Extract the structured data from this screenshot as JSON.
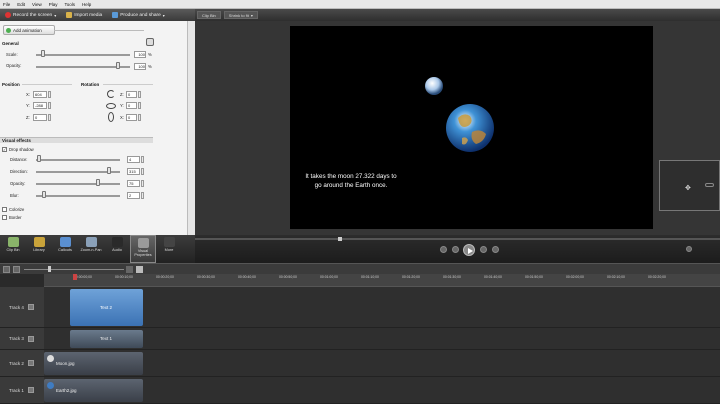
{
  "menu": [
    "File",
    "Edit",
    "View",
    "Play",
    "Tools",
    "Help"
  ],
  "toolbar": {
    "record": "Record the screen",
    "import": "Import media",
    "produce": "Produce and share"
  },
  "right_toolbar": {
    "btn1": "Clip Bin",
    "btn2": "Shrink to fit"
  },
  "panel": {
    "add_animation": "Add animation",
    "general": "General",
    "scale_label": "Scale:",
    "scale_value": "100",
    "opacity_label": "Opacity:",
    "opacity_value": "100",
    "pct": "%",
    "position": "Position",
    "rotation": "Rotation",
    "pos_x_label": "X:",
    "pos_x": "604",
    "pos_y_label": "Y:",
    "pos_y": "-288",
    "pos_z_label": "Z:",
    "pos_z": "0",
    "rot_z_label": "Z:",
    "rot_z": "0",
    "rot_y_label": "Y:",
    "rot_y": "0",
    "rot_x_label": "X:",
    "rot_x": "0",
    "visual_effects": "Visual effects",
    "drop_shadow": "Drop shadow",
    "distance_label": "Distance:",
    "distance": "4",
    "direction_label": "Direction:",
    "direction": "315",
    "sh_opacity_label": "Opacity:",
    "sh_opacity": "75",
    "blur_label": "Blur:",
    "blur": "2",
    "colorize": "Colorize",
    "border": "Border"
  },
  "tasks": [
    {
      "label": "Clip Bin",
      "color": "#8ab46a"
    },
    {
      "label": "Library",
      "color": "#c9a33a"
    },
    {
      "label": "Callouts",
      "color": "#5a8fd0"
    },
    {
      "label": "Zoom-n-Pan",
      "color": "#8aa0b8"
    },
    {
      "label": "Audio",
      "color": "#2a2a2a"
    },
    {
      "label": "Visual Properties",
      "color": "#9a9a9a"
    },
    {
      "label": "More",
      "color": "#444"
    }
  ],
  "preview": {
    "caption": "It takes the moon 27.322 days to go around the Earth once."
  },
  "ruler_ticks": [
    "00:00:00;00",
    "00:00:10;00",
    "00:00:20;00",
    "00:00:30;00",
    "00:00:40;00",
    "00:00:50;00",
    "00:01:00;00",
    "00:01:10;00",
    "00:01:20;00",
    "00:01:30;00",
    "00:01:40;00",
    "00:01:50;00",
    "00:02:00;00",
    "00:02:10;00",
    "00:02:20;00"
  ],
  "tracks": [
    {
      "name": "Track 4",
      "clip": "Text 2"
    },
    {
      "name": "Track 3",
      "clip": "Text 1"
    },
    {
      "name": "Track 2",
      "clip": "Moon.jpg"
    },
    {
      "name": "Track 1",
      "clip": "Earth2.jpg"
    }
  ]
}
